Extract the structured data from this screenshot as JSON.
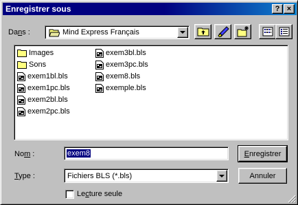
{
  "window": {
    "title": "Enregistrer sous",
    "help_label": "?",
    "close_label": "×"
  },
  "location": {
    "label_pre": "Da",
    "label_key": "n",
    "label_post": "s :",
    "folder": "Mind Express Français"
  },
  "files": {
    "col1": [
      {
        "name": "Images",
        "type": "folder-icon"
      },
      {
        "name": "Sons",
        "type": "folder-icon"
      },
      {
        "name": "exem1bl.bls",
        "type": "bls-file-icon"
      },
      {
        "name": "exem1pc.bls",
        "type": "bls-file-icon"
      },
      {
        "name": "exem2bl.bls",
        "type": "bls-file-icon"
      },
      {
        "name": "exem2pc.bls",
        "type": "bls-file-icon"
      }
    ],
    "col2": [
      {
        "name": "exem3bl.bls",
        "type": "bls-file-icon"
      },
      {
        "name": "exem3pc.bls",
        "type": "bls-file-icon"
      },
      {
        "name": "exem8.bls",
        "type": "bls-file-icon"
      },
      {
        "name": "exemple.bls",
        "type": "bls-file-icon"
      }
    ]
  },
  "filename": {
    "label_pre": "No",
    "label_key": "m",
    "label_post": " :",
    "value": "exem8"
  },
  "filetype": {
    "label_key": "T",
    "label_post": "ype :",
    "value": "Fichiers BLS (*.bls)"
  },
  "readonly": {
    "label_pre": "Le",
    "label_key": "c",
    "label_post": "ture seule",
    "checked": false
  },
  "buttons": {
    "save_key": "E",
    "save_rest": "nregistrer",
    "cancel": "Annuler"
  },
  "colors": {
    "title_bg": "#000080",
    "selection": "#000080",
    "face": "#c0c0c0"
  }
}
